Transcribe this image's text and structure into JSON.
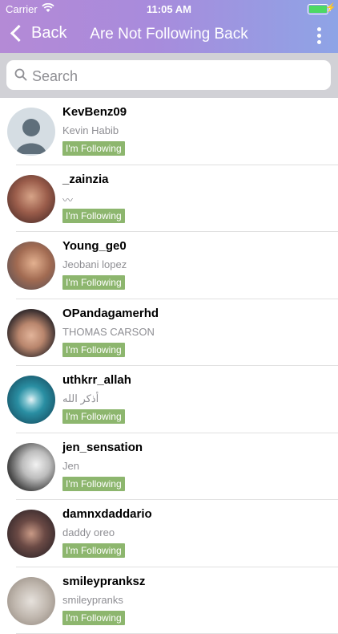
{
  "status_bar": {
    "carrier": "Carrier",
    "time": "11:05 AM"
  },
  "nav": {
    "back_label": "Back",
    "title": "Are Not Following Back"
  },
  "search": {
    "placeholder": "Search"
  },
  "colors": {
    "accent_gradient_start": "#b48ad6",
    "accent_gradient_end": "#8ea4e6",
    "badge": "#8db66e"
  },
  "users": [
    {
      "username": "KevBenz09",
      "name": "Kevin Habib",
      "badge": "I'm Following"
    },
    {
      "username": "_zainzia",
      "name": "〰",
      "badge": "I'm Following"
    },
    {
      "username": "Young_ge0",
      "name": "Jeobani lopez",
      "badge": "I'm Following"
    },
    {
      "username": "OPandagamerhd",
      "name": "THOMAS CARSON",
      "badge": "I'm Following"
    },
    {
      "username": "uthkrr_allah",
      "name": "أذكر الله",
      "badge": "I'm Following"
    },
    {
      "username": "jen_sensation",
      "name": "Jen",
      "badge": "I'm Following"
    },
    {
      "username": "damnxdaddario",
      "name": "daddy oreo",
      "badge": "I'm Following"
    },
    {
      "username": "smileypranksz",
      "name": "smileypranks",
      "badge": "I'm Following"
    }
  ]
}
